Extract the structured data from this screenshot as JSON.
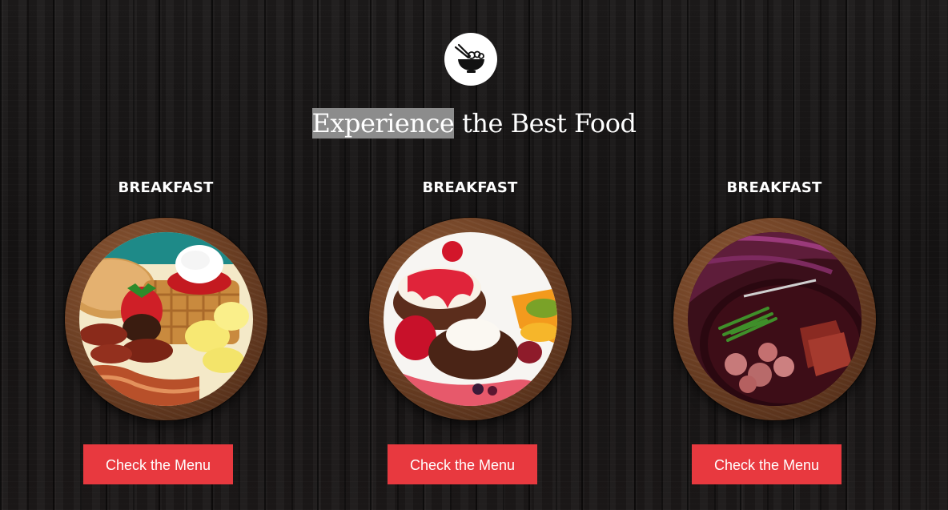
{
  "header": {
    "logo_icon": "noodle-bowl-with-chopsticks-icon",
    "headline_highlight": "Experience",
    "headline_rest": " the Best Food"
  },
  "cards": [
    {
      "title": "BREAKFAST",
      "button_label": "Check the Menu",
      "image": "breakfast-waffles-strawberry-sausage"
    },
    {
      "title": "BREAKFAST",
      "button_label": "Check the Menu",
      "image": "chocolate-cake-with-berries-and-cream"
    },
    {
      "title": "BREAKFAST",
      "button_label": "Check the Menu",
      "image": "steak-green-beans-potatoes-plate"
    }
  ],
  "colors": {
    "button": "#e8393f",
    "headline_highlight": "#8c8c8c",
    "plate_wood": "#6d4024"
  }
}
